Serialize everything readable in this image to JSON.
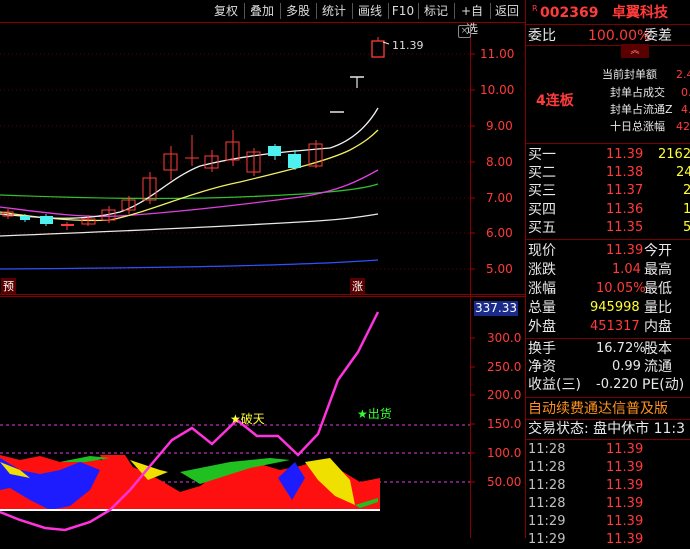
{
  "toolbar": {
    "items": [
      "复权",
      "叠加",
      "多股",
      "统计",
      "画线",
      "F10",
      "标记",
      "+自选",
      "返回"
    ]
  },
  "main_chart": {
    "price_axis": [
      "11.00",
      "10.00",
      "9.00",
      "8.00",
      "7.00",
      "6.00",
      "5.00"
    ],
    "last_price_label": "11.39",
    "left_marker": "预",
    "right_marker": "涨"
  },
  "indicator": {
    "axis": [
      "300.0",
      "250.0",
      "200.0",
      "150.0",
      "100.0",
      "50.00"
    ],
    "current_value": "337.33",
    "signal_break": "破天",
    "signal_exit": "出货"
  },
  "colors": {
    "background": "#000000",
    "up": "#ff3b3b",
    "down": "#4ff0f0",
    "ma_white": "#f0f0f0",
    "ma_yellow": "#f0f060",
    "ma_magenta": "#e040e0",
    "ma_green": "#30c030",
    "ma_blue": "#3050ff",
    "indicator_line": "#ff33dd"
  },
  "panel": {
    "code": "002369",
    "name": "卓翼科技",
    "weibi_label": "委比",
    "weibi_value": "100.00%",
    "weicha_label": "委差",
    "streak": "4连板",
    "info_labels": [
      "当前封单额",
      "封单占成交",
      "封单占流通Z",
      "十日总涨幅"
    ],
    "info_values": [
      "2.4",
      "0.2",
      "4.",
      "42"
    ],
    "bids": [
      {
        "label": "买一",
        "price": "11.39",
        "vol": "2162"
      },
      {
        "label": "买二",
        "price": "11.38",
        "vol": "24"
      },
      {
        "label": "买三",
        "price": "11.37",
        "vol": "2"
      },
      {
        "label": "买四",
        "price": "11.36",
        "vol": "1"
      },
      {
        "label": "买五",
        "price": "11.35",
        "vol": "5"
      }
    ],
    "quote_rows": [
      {
        "l": "现价",
        "v": "11.39",
        "r": "今开"
      },
      {
        "l": "涨跌",
        "v": "1.04",
        "r": "最高"
      },
      {
        "l": "涨幅",
        "v": "10.05%",
        "r": "最低"
      },
      {
        "l": "总量",
        "v": "945998",
        "r": "量比"
      },
      {
        "l": "外盘",
        "v": "451317",
        "r": "内盘"
      }
    ],
    "stat_rows": [
      {
        "l": "换手",
        "v": "16.72%",
        "r": "股本"
      },
      {
        "l": "净资",
        "v": "0.99",
        "r": "流通"
      },
      {
        "l": "收益(三)",
        "v": "-0.220",
        "r": "PE(动)"
      }
    ],
    "banner": "自动续费通达信普及版",
    "trade_status": "交易状态: 盘中休市 11:3",
    "ticks": [
      {
        "t": "11:28",
        "p": "11.39"
      },
      {
        "t": "11:28",
        "p": "11.39"
      },
      {
        "t": "11:28",
        "p": "11.39"
      },
      {
        "t": "11:28",
        "p": "11.39"
      },
      {
        "t": "11:29",
        "p": "11.39"
      },
      {
        "t": "11:29",
        "p": "11.39"
      }
    ]
  }
}
